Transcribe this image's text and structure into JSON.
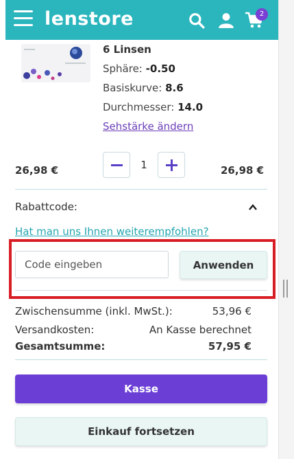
{
  "header": {
    "logo": "lenstore",
    "cart_count": "2",
    "accent_color": "#2bb5bd",
    "icons": [
      "menu-icon",
      "search-icon",
      "user-icon",
      "cart-icon"
    ]
  },
  "product": {
    "title": "6 Linsen",
    "lines": [
      {
        "label": "Sphäre:",
        "value": "-0.50"
      },
      {
        "label": "Basiskurve:",
        "value": "8.6"
      },
      {
        "label": "Durchmesser:",
        "value": "14.0"
      }
    ],
    "change_link": "Sehstärke ändern",
    "unit_price": "26,98 €",
    "line_total": "26,98 €",
    "quantity": "1"
  },
  "coupon": {
    "label": "Rabattcode:",
    "referral_link": "Hat man uns Ihnen weiterempfohlen?",
    "input_placeholder": "Code eingeben",
    "input_value": "",
    "apply_label": "Anwenden"
  },
  "summary": {
    "rows": [
      {
        "label": "Zwischensumme (inkl. MwSt.):",
        "value": "53,96 €"
      },
      {
        "label": "Versandkosten:",
        "value": "An Kasse berechnet"
      },
      {
        "label": "Gesamtsumme:",
        "value": "57,95 €"
      }
    ]
  },
  "actions": {
    "checkout_label": "Kasse",
    "continue_label": "Einkauf fortsetzen",
    "checkout_color": "#6b3fd6"
  },
  "highlight_color": "#d81e25"
}
